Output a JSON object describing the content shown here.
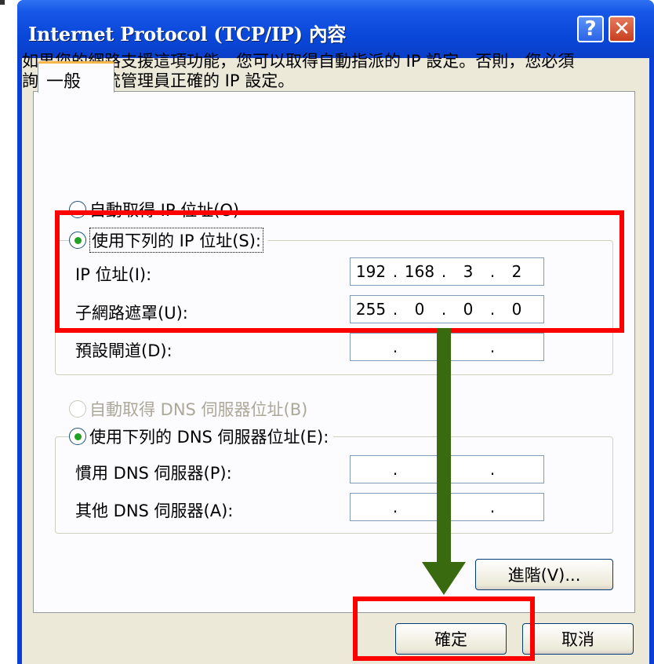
{
  "window": {
    "title": "Internet Protocol (TCP/IP) 內容",
    "help_glyph": "?",
    "close_glyph": "✕"
  },
  "tab": {
    "label": "一般"
  },
  "description": "如果您的網路支援這項功能，您可以取得自動指派的 IP 設定。否則，您必須詢問網路系統管理員正確的 IP 設定。",
  "ip": {
    "auto_option": "自動取得 IP 位址(O)",
    "auto_selected": false,
    "manual_option": "使用下列的 IP 位址(S):",
    "manual_selected": true,
    "address_label": "IP 位址(I):",
    "address": [
      "192",
      "168",
      "3",
      "2"
    ],
    "subnet_label": "子網路遮罩(U):",
    "subnet": [
      "255",
      "0",
      "0",
      "0"
    ],
    "gateway_label": "預設閘道(D):",
    "gateway": [
      "",
      "",
      "",
      ""
    ]
  },
  "dns": {
    "auto_option": "自動取得 DNS 伺服器位址(B)",
    "auto_enabled": false,
    "manual_option": "使用下列的 DNS 伺服器位址(E):",
    "manual_selected": true,
    "preferred_label": "慣用 DNS 伺服器(P):",
    "preferred": [
      "",
      "",
      "",
      ""
    ],
    "alternate_label": "其他 DNS 伺服器(A):",
    "alternate": [
      "",
      "",
      "",
      ""
    ]
  },
  "buttons": {
    "advanced": "進階(V)...",
    "ok": "確定",
    "cancel": "取消"
  },
  "colors": {
    "title_bar": "#0a48da",
    "highlight_box": "#ff0000",
    "arrow": "#3a6a10",
    "radio_dot": "#21a121"
  }
}
